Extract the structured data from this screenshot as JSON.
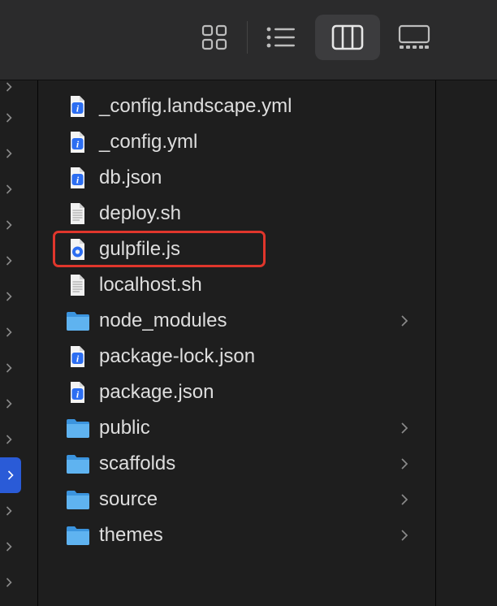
{
  "toolbar": {
    "buttons": [
      {
        "name": "icon-view-icon"
      },
      {
        "name": "list-view-icon"
      },
      {
        "name": "column-view-icon",
        "active": true
      },
      {
        "name": "gallery-view-icon"
      }
    ]
  },
  "files": [
    {
      "name": "_config.landscape.yml",
      "icon": "json-info-icon",
      "folder": false
    },
    {
      "name": "_config.yml",
      "icon": "json-info-icon",
      "folder": false
    },
    {
      "name": "db.json",
      "icon": "json-info-icon",
      "folder": false
    },
    {
      "name": "deploy.sh",
      "icon": "text-document-icon",
      "folder": false
    },
    {
      "name": "gulpfile.js",
      "icon": "js-file-icon",
      "folder": false,
      "highlighted": true
    },
    {
      "name": "localhost.sh",
      "icon": "text-document-icon",
      "folder": false
    },
    {
      "name": "node_modules",
      "icon": "folder-icon",
      "folder": true
    },
    {
      "name": "package-lock.json",
      "icon": "json-info-icon",
      "folder": false
    },
    {
      "name": "package.json",
      "icon": "json-info-icon",
      "folder": false
    },
    {
      "name": "public",
      "icon": "folder-icon",
      "folder": true
    },
    {
      "name": "scaffolds",
      "icon": "folder-icon",
      "folder": true
    },
    {
      "name": "source",
      "icon": "folder-icon",
      "folder": true
    },
    {
      "name": "themes",
      "icon": "folder-icon",
      "folder": true
    }
  ],
  "colors": {
    "accent": "#2a5bd7",
    "highlight_border": "#e0362c",
    "folder": "#4aa3e8"
  }
}
